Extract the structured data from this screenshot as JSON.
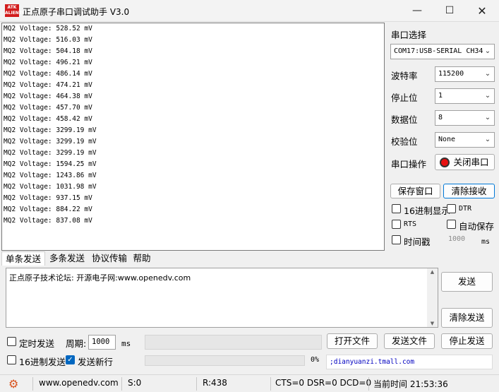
{
  "window": {
    "logo_text": "ATK",
    "title": "正点原子串口调试助手 V3.0",
    "min_icon": "minimize-icon",
    "max_icon": "maximize-icon",
    "close_icon": "close-icon"
  },
  "receive_lines": [
    "MQ2 Voltage: 528.52 mV",
    "MQ2 Voltage: 516.03 mV",
    "MQ2 Voltage: 504.18 mV",
    "MQ2 Voltage: 496.21 mV",
    "MQ2 Voltage: 486.14 mV",
    "MQ2 Voltage: 474.21 mV",
    "MQ2 Voltage: 464.38 mV",
    "MQ2 Voltage: 457.70 mV",
    "MQ2 Voltage: 458.42 mV",
    "MQ2 Voltage: 3299.19 mV",
    "MQ2 Voltage: 3299.19 mV",
    "MQ2 Voltage: 3299.19 mV",
    "MQ2 Voltage: 1594.25 mV",
    "MQ2 Voltage: 1243.86 mV",
    "MQ2 Voltage: 1031.98 mV",
    "MQ2 Voltage: 937.15 mV",
    "MQ2 Voltage: 884.22 mV",
    "MQ2 Voltage: 837.08 mV"
  ],
  "port_panel": {
    "select_label": "串口选择",
    "port_value": "COM17:USB-SERIAL CH34",
    "baud_label": "波特率",
    "baud_value": "115200",
    "stop_label": "停止位",
    "stop_value": "1",
    "data_label": "数据位",
    "data_value": "8",
    "parity_label": "校验位",
    "parity_value": "None",
    "op_label": "串口操作",
    "close_port_label": "关闭串口",
    "save_window_label": "保存窗口",
    "clear_recv_label": "清除接收",
    "hex_display_label": "16进制显示",
    "dtr_label": "DTR",
    "rts_label": "RTS",
    "autosave_label": "自动保存",
    "timestamp_label": "时间戳",
    "timestamp_value": "1000",
    "timestamp_unit": "ms",
    "status_color": "#e81010"
  },
  "tabs": [
    "单条发送",
    "多条发送",
    "协议传输",
    "帮助"
  ],
  "send": {
    "text": "正点原子技术论坛: 开源电子网:www.openedv.com",
    "send_label": "发送",
    "clear_send_label": "清除发送",
    "timed_send_label": "定时发送",
    "period_label": "周期:",
    "period_value": "1000",
    "period_unit": "ms",
    "open_file_label": "打开文件",
    "send_file_label": "发送文件",
    "stop_send_label": "停止发送",
    "hex_send_label": "16进制发送",
    "newline_label": "发送新行",
    "progress_percent": "0%",
    "progress_value": 0,
    "link_text": ";dianyuanzi.tmall.com"
  },
  "status": {
    "gear_icon": "gear-icon",
    "website": "www.openedv.com",
    "sent": "S:0",
    "received": "R:438",
    "lines": "CTS=0 DSR=0 DCD=0",
    "time": "当前时间 21:53:36"
  }
}
